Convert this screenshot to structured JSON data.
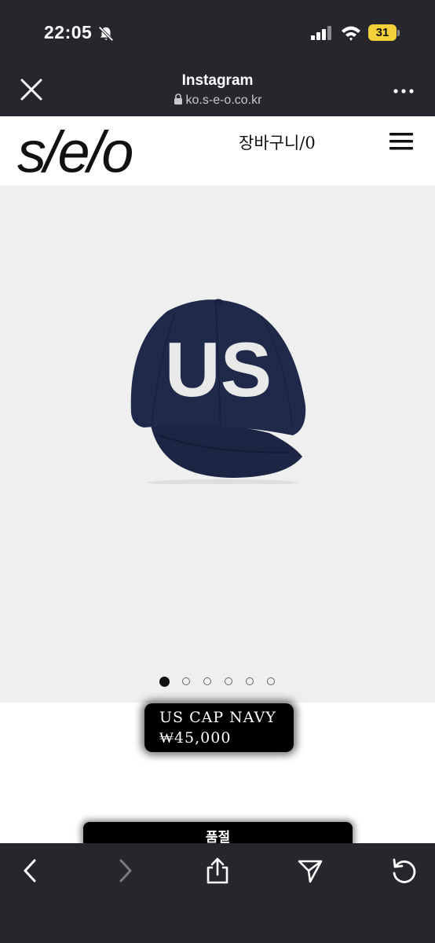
{
  "status_bar": {
    "time": "22:05",
    "battery_level": "31",
    "icons": [
      "bell-muted-icon",
      "signal-icon",
      "wifi-icon",
      "battery-icon"
    ]
  },
  "browser": {
    "title": "Instagram",
    "url": "ko.s-e-o.co.kr",
    "icons": [
      "close-icon",
      "lock-icon",
      "more-icon"
    ]
  },
  "site": {
    "logo": "s/e/o",
    "cart_label": "장바구니",
    "cart_separator": "/",
    "cart_count": "0",
    "menu_icon": "hamburger-menu-icon"
  },
  "carousel": {
    "image": "navy-us-cap-image",
    "cap_text": "US",
    "total_slides": 6,
    "active_index": 0
  },
  "product": {
    "name": "US CAP NAVY",
    "price": "₩45,000",
    "button_label": "품절"
  },
  "toolbar": {
    "icons": [
      "back-arrow-icon",
      "forward-arrow-icon",
      "share-icon",
      "send-icon",
      "reload-icon"
    ]
  },
  "colors": {
    "chrome_bg": "#25272d",
    "image_bg": "#efeff0",
    "cap_navy": "#1f2a4a",
    "battery": "#f4d13b"
  }
}
